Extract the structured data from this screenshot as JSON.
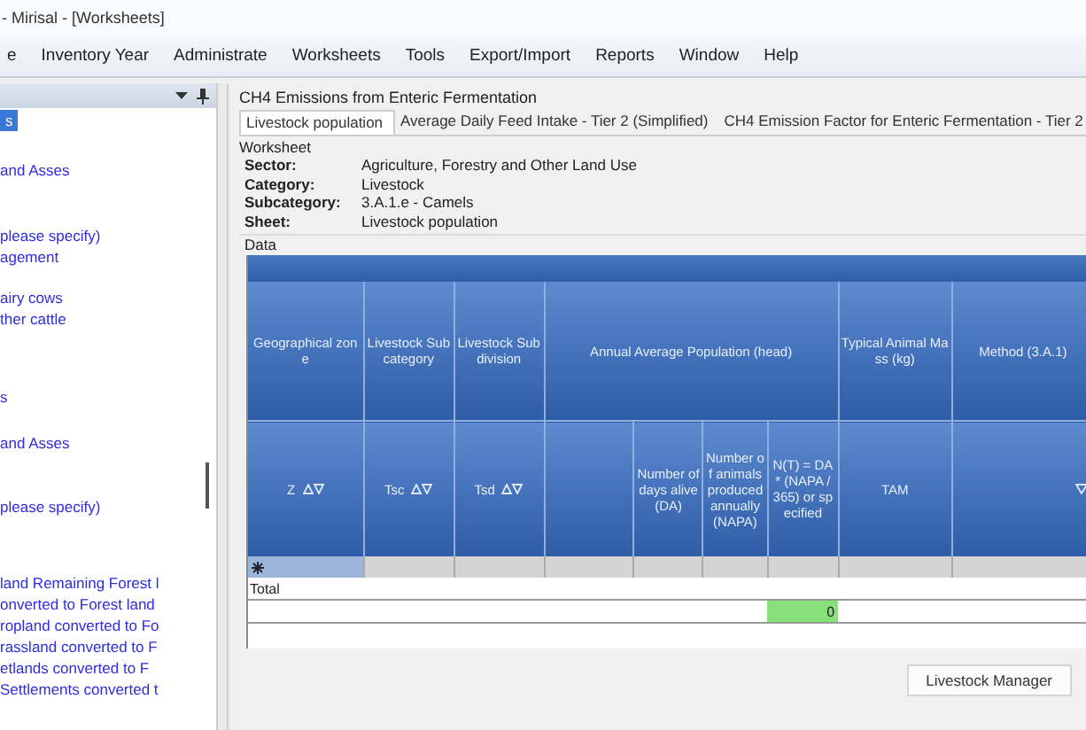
{
  "window": {
    "title": "- Mirisal - [Worksheets]"
  },
  "menu": [
    "e",
    "Inventory Year",
    "Administrate",
    "Worksheets",
    "Tools",
    "Export/Import",
    "Reports",
    "Window",
    "Help"
  ],
  "sidebar": {
    "items": [
      {
        "label": "s",
        "selected": true
      },
      {
        "label": "and Asses",
        "selected": false
      },
      {
        "label": "please specify)",
        "selected": false
      },
      {
        "label": "agement",
        "selected": false
      },
      {
        "label": "airy cows",
        "selected": false
      },
      {
        "label": "ther cattle",
        "selected": false
      },
      {
        "label": "s",
        "selected": false
      },
      {
        "label": "and Asses",
        "selected": false
      },
      {
        "label": "please specify)",
        "selected": false
      },
      {
        "label": "land Remaining Forest l",
        "selected": false
      },
      {
        "label": "onverted to Forest land",
        "selected": false
      },
      {
        "label": "ropland converted to Fo",
        "selected": false
      },
      {
        "label": "rassland converted to F",
        "selected": false
      },
      {
        "label": "etlands converted to F",
        "selected": false
      },
      {
        "label": "Settlements converted t",
        "selected": false
      }
    ]
  },
  "panel": {
    "title": "CH4 Emissions from Enteric Fermentation",
    "tabs": [
      {
        "label": "Livestock population",
        "selected": true
      },
      {
        "label": "Average Daily Feed Intake - Tier 2 (Simplified)",
        "selected": false
      },
      {
        "label": "CH4 Emission Factor for Enteric Fermentation - Tier 2",
        "selected": false
      }
    ],
    "worksheet_label": "Worksheet",
    "fields": [
      {
        "label": "Sector:",
        "value": "Agriculture, Forestry and Other Land Use"
      },
      {
        "label": "Category:",
        "value": "Livestock"
      },
      {
        "label": "Subcategory:",
        "value": "3.A.1.e - Camels"
      },
      {
        "label": "Sheet:",
        "value": "Livestock population"
      }
    ],
    "data_label": "Data"
  },
  "table": {
    "columns": [
      {
        "kind": "single",
        "heading": "Geographical zone",
        "code": "Z",
        "sortable": true
      },
      {
        "kind": "single",
        "heading": "Livestock Subcategory",
        "code": "Tsc",
        "sortable": true
      },
      {
        "kind": "single",
        "heading": "Livestock Subdivision",
        "code": "Tsd",
        "sortable": true
      },
      {
        "kind": "group",
        "heading": "Annual Average Population (head)",
        "subcolumns": [
          {
            "kind": "blank"
          },
          {
            "kind": "text",
            "heading": "Number of days alive (DA)"
          },
          {
            "kind": "text",
            "heading": "Number of animals produced annually (NAPA)"
          },
          {
            "kind": "text",
            "heading": "N(T) = DA * (NAPA / 365) or specified",
            "total": true
          }
        ]
      },
      {
        "kind": "single",
        "heading": "Typical Animal Mass (kg)",
        "code": "TAM",
        "sortable": false
      },
      {
        "kind": "filter",
        "heading": "Method (3.A.1)"
      }
    ],
    "total_label": "Total",
    "total_value": {
      "value": "0",
      "highlighted": true
    }
  },
  "buttons": [
    "Livestock Manager"
  ]
}
